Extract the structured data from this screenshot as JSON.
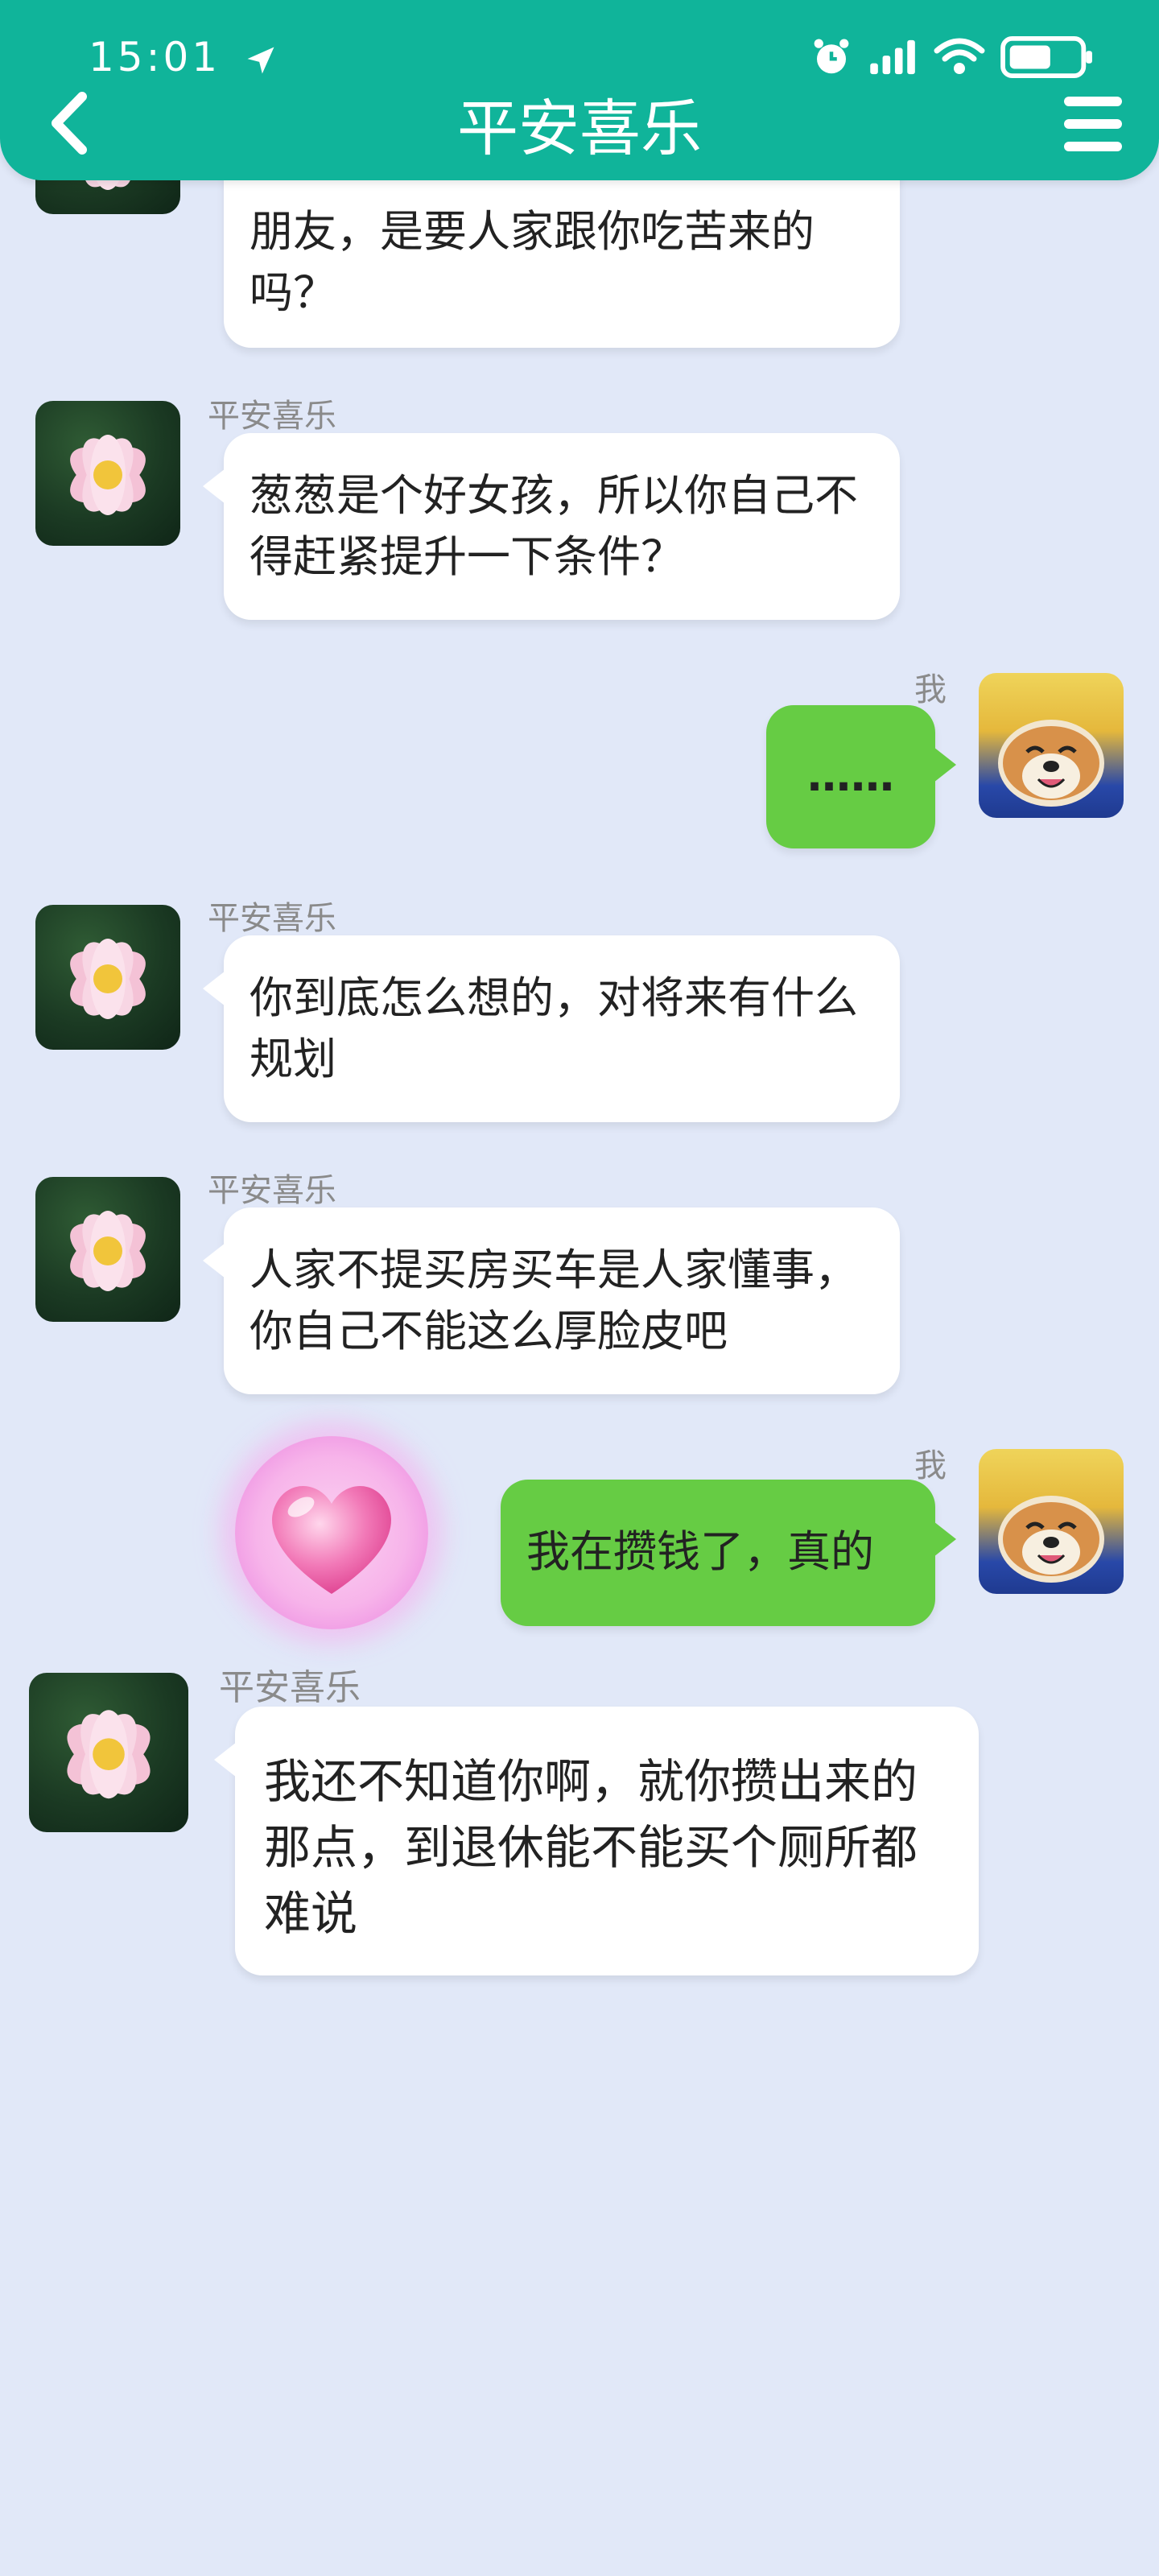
{
  "status_bar": {
    "time": "15:01"
  },
  "header": {
    "title": "平安喜乐"
  },
  "messages": [
    {
      "sender": "",
      "text": "朋友，是要人家跟你吃苦来的吗？"
    },
    {
      "sender": "平安喜乐",
      "text": "葱葱是个好女孩，所以你自己不得赶紧提升一下条件？"
    },
    {
      "sender": "我",
      "text": "……"
    },
    {
      "sender": "平安喜乐",
      "text": "你到底怎么想的，对将来有什么规划"
    },
    {
      "sender": "平安喜乐",
      "text": "人家不提买房买车是人家懂事，你自己不能这么厚脸皮吧"
    },
    {
      "sender": "我",
      "text": "我在攒钱了，真的"
    },
    {
      "sender": "平安喜乐",
      "text": "我还不知道你啊，就你攒出来的那点，到退休能不能买个厕所都难说"
    }
  ],
  "colors": {
    "header": "#10b49a",
    "background": "#e1e8f8",
    "my_bubble": "#66cc44",
    "their_bubble": "#ffffff"
  }
}
